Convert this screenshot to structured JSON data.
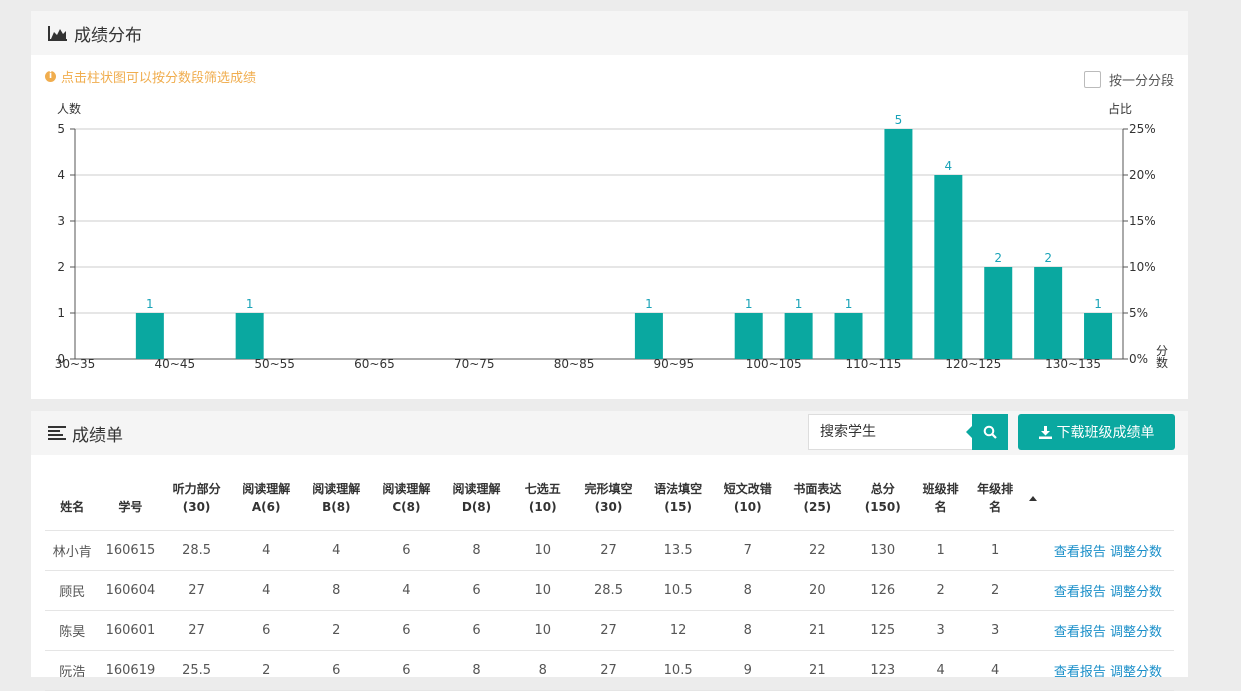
{
  "distribution": {
    "title": "成绩分布",
    "hint": "点击柱状图可以按分数段筛选成绩",
    "toggle_label": "按一分分段",
    "icons": {
      "header": "area-chart-icon",
      "hint": "info-circle-icon"
    }
  },
  "chart_data": {
    "type": "bar",
    "ylabel": "人数",
    "y2label": "占比",
    "xlabel": "分数",
    "ylim": [
      0,
      5
    ],
    "y_ticks": [
      "0",
      "1",
      "2",
      "3",
      "4",
      "5"
    ],
    "y2_ticks": [
      "0%",
      "5%",
      "10%",
      "15%",
      "20%",
      "25%"
    ],
    "categories": [
      "30~35",
      "35~40",
      "40~45",
      "45~50",
      "50~55",
      "55~60",
      "60~65",
      "65~70",
      "70~75",
      "75~80",
      "80~85",
      "85~90",
      "90~95",
      "95~100",
      "100~105",
      "105~110",
      "110~115",
      "115~120",
      "120~125",
      "125~130",
      "130~135"
    ],
    "tick_labels": [
      "30~35",
      "",
      "40~45",
      "",
      "50~55",
      "",
      "60~65",
      "",
      "70~75",
      "",
      "80~85",
      "",
      "90~95",
      "",
      "100~105",
      "",
      "110~115",
      "",
      "120~125",
      "",
      "130~135"
    ],
    "values": [
      0,
      1,
      0,
      1,
      0,
      0,
      0,
      0,
      0,
      0,
      0,
      1,
      0,
      1,
      1,
      1,
      5,
      4,
      2,
      2,
      1
    ],
    "bar_color": "#0aa8a0",
    "label_color": "#1aa3b8",
    "grid": true
  },
  "grades": {
    "title": "成绩单",
    "search_placeholder": "搜索学生",
    "download_label": "下载班级成绩单",
    "icons": {
      "header": "list-icon",
      "search": "search-icon",
      "download": "download-icon"
    },
    "columns": [
      {
        "l1": "",
        "l2": "姓名"
      },
      {
        "l1": "",
        "l2": "学号"
      },
      {
        "l1": "听力部分",
        "l2": "(30)"
      },
      {
        "l1": "阅读理解",
        "l2": "A(6)"
      },
      {
        "l1": "阅读理解",
        "l2": "B(8)"
      },
      {
        "l1": "阅读理解",
        "l2": "C(8)"
      },
      {
        "l1": "阅读理解",
        "l2": "D(8)"
      },
      {
        "l1": "七选五",
        "l2": "(10)"
      },
      {
        "l1": "完形填空",
        "l2": "(30)"
      },
      {
        "l1": "语法填空",
        "l2": "(15)"
      },
      {
        "l1": "短文改错",
        "l2": "(10)"
      },
      {
        "l1": "书面表达",
        "l2": "(25)"
      },
      {
        "l1": "总分",
        "l2": "(150)"
      },
      {
        "l1": "班级排",
        "l2": "名"
      },
      {
        "l1": "年级排",
        "l2": "名"
      }
    ],
    "action_view": "查看报告",
    "action_adjust": "调整分数",
    "rows": [
      [
        "林小肯",
        "160615",
        "28.5",
        "4",
        "4",
        "6",
        "8",
        "10",
        "27",
        "13.5",
        "7",
        "22",
        "130",
        "1",
        "1"
      ],
      [
        "顾民",
        "160604",
        "27",
        "4",
        "8",
        "4",
        "6",
        "10",
        "28.5",
        "10.5",
        "8",
        "20",
        "126",
        "2",
        "2"
      ],
      [
        "陈昊",
        "160601",
        "27",
        "6",
        "2",
        "6",
        "6",
        "10",
        "27",
        "12",
        "8",
        "21",
        "125",
        "3",
        "3"
      ],
      [
        "阮浩",
        "160619",
        "25.5",
        "2",
        "6",
        "6",
        "8",
        "8",
        "27",
        "10.5",
        "9",
        "21",
        "123",
        "4",
        "4"
      ]
    ]
  }
}
